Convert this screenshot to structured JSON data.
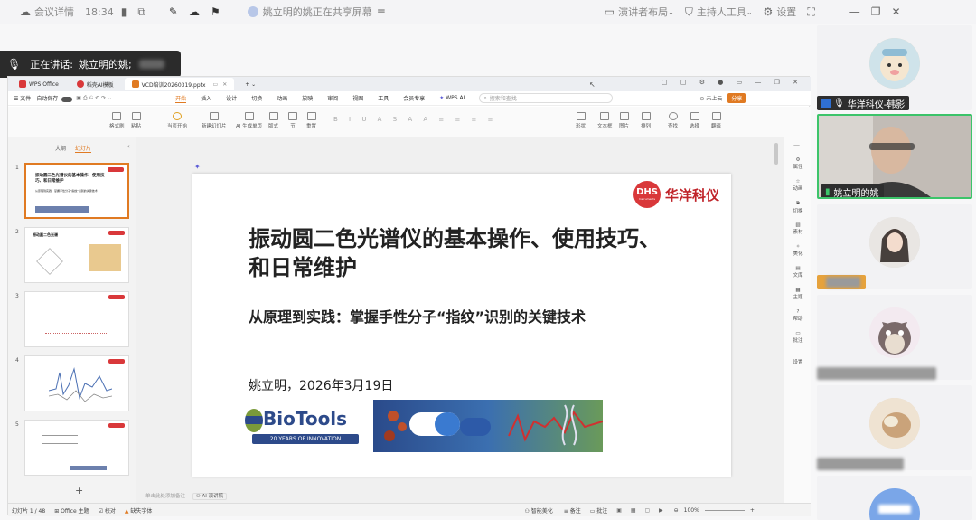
{
  "meeting": {
    "title": "会议详情",
    "time": "18:34",
    "share_status": "姚立明的姚正在共享屏幕",
    "presenter_layout": "演讲者布局",
    "host_tools": "主持人工具",
    "settings": "设置",
    "speaking_label": "正在讲话:",
    "speaking_name": "姚立明的姚;"
  },
  "wps": {
    "tabs": [
      {
        "label": "WPS Office",
        "color": "#d9383a"
      },
      {
        "label": "稻壳AI模板",
        "color": "#d9383a"
      },
      {
        "label": "VCD培训20260319.pptx",
        "color": "#e07a22"
      }
    ],
    "menu": {
      "file": "文件",
      "autosave": "自动保存",
      "items": [
        "开始",
        "插入",
        "设计",
        "切换",
        "动画",
        "放映",
        "审阅",
        "视图",
        "工具",
        "会员专享"
      ],
      "wps_ai": "WPS AI",
      "search_placeholder": "搜索和查找",
      "cloud": "未上云",
      "share": "分享"
    },
    "ribbon": {
      "format_painter": "格式刷",
      "paste": "粘贴",
      "start_from_current": "当页开始",
      "new_slide": "新建幻灯片",
      "ai_gen": "AI 生成单页",
      "layout": "版式",
      "section": "节",
      "reset": "重置",
      "shape": "形状",
      "picture": "图片",
      "textbox": "文本框",
      "arrange": "排列",
      "find": "查找",
      "select": "选择",
      "translate": "翻译"
    },
    "left_panel": {
      "outline": "大纲",
      "slides": "幻灯片",
      "thumb_numbers": [
        "1",
        "2",
        "3",
        "4",
        "5"
      ],
      "thumb1_title": "振动圆二色光谱仪的基本操作、使用技巧、和日常维护",
      "thumb1_sub": "从原理到实践：掌握手性分子\"指纹\"识别的关键技术",
      "thumb2_title": "振动圆二色光谱",
      "add_slide": "+"
    },
    "slide": {
      "title": "振动圆二色光谱仪的基本操作、使用技巧、和日常维护",
      "subtitle": "从原理到实践：掌握手性分子“指纹”识别的关键技术",
      "author_date": "姚立明，2026年3月19日",
      "logo_dhs": "DHS",
      "logo_dhs_small": "Instruments",
      "logo_cn": "华洋科仪",
      "biotools": "BioTools",
      "biotools_tag": "20 YEARS OF INNOVATION"
    },
    "notes_placeholder": "单击此处添加备注",
    "ai_notes": "AI 演讲稿",
    "rail": [
      "属性",
      "动画",
      "切换",
      "素材",
      "美化",
      "文库",
      "主题",
      "帮助",
      "批注",
      "设置"
    ],
    "status": {
      "slide_count": "幻灯片 1 / 48",
      "theme": "Office 主题",
      "proof": "校对",
      "missing_font": "缺失字体",
      "smart_beautify": "智能美化",
      "notes": "备注",
      "comments": "批注",
      "zoom": "100%"
    }
  },
  "participants": {
    "items": [
      {
        "name": "华洋科仪-韩影"
      },
      {
        "name": "姚立明的姚"
      }
    ]
  }
}
